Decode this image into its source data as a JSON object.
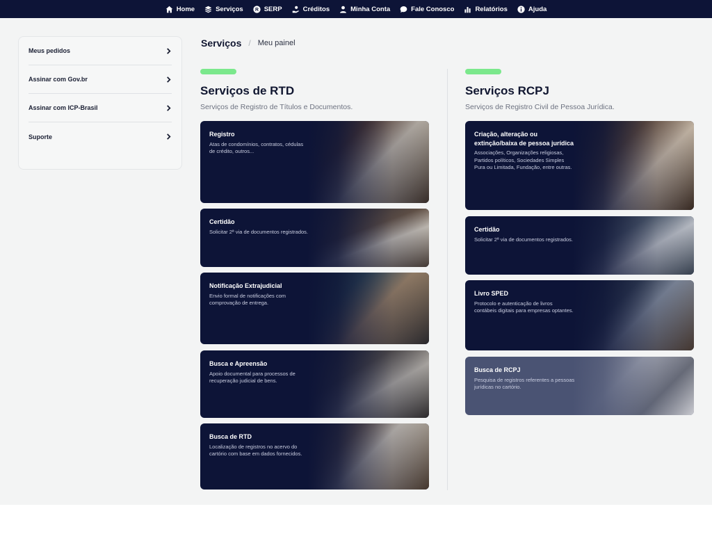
{
  "nav": {
    "items": [
      {
        "label": "Home",
        "icon": "home-icon"
      },
      {
        "label": "Serviços",
        "icon": "layers-icon"
      },
      {
        "label": "SERP",
        "icon": "registered-icon"
      },
      {
        "label": "Créditos",
        "icon": "hand-coin-icon"
      },
      {
        "label": "Minha Conta",
        "icon": "user-icon"
      },
      {
        "label": "Fale Conosco",
        "icon": "chat-icon"
      },
      {
        "label": "Relatórios",
        "icon": "bar-chart-icon"
      },
      {
        "label": "Ajuda",
        "icon": "info-icon"
      }
    ]
  },
  "sidebar": {
    "items": [
      {
        "label": "Meus pedidos"
      },
      {
        "label": "Assinar com Gov.br"
      },
      {
        "label": "Assinar com ICP-Brasil"
      },
      {
        "label": "Suporte"
      }
    ]
  },
  "breadcrumb": {
    "current": "Serviços",
    "separator": "/",
    "sub": "Meu painel"
  },
  "rtd": {
    "title": "Serviços de RTD",
    "subtitle": "Serviços de Registro de Títulos e Documentos.",
    "cards": [
      {
        "title": "Registro",
        "desc": "Atas de condomínios, contratos, cédulas de crédito, outros..."
      },
      {
        "title": "Certidão",
        "desc": "Solicitar 2ª via de documentos registrados."
      },
      {
        "title": "Notificação Extrajudicial",
        "desc": "Envio formal de notificações com comprovação de entrega."
      },
      {
        "title": "Busca e Apreensão",
        "desc": "Apoio documental para processos de recuperação judicial de bens."
      },
      {
        "title": "Busca de RTD",
        "desc": "Localização de registros no acervo do cartório com base em dados fornecidos."
      }
    ]
  },
  "rcpj": {
    "title": "Serviços RCPJ",
    "subtitle": "Serviços de Registro Civil de Pessoa Jurídica.",
    "cards": [
      {
        "title": "Criação, alteração ou extinção/baixa de pessoa jurídica",
        "desc": "Associações, Organizações religiosas, Partidos políticos, Sociedades Simples Pura ou Limitada, Fundação, entre outras."
      },
      {
        "title": "Certidão",
        "desc": "Solicitar 2ª via de documentos registrados."
      },
      {
        "title": "Livro SPED",
        "desc": "Protocolo e autenticação de livros contábeis digitais para empresas optantes."
      },
      {
        "title": "Busca de RCPJ",
        "desc": "Pesquisa de registros referentes a pessoas jurídicas no cartório."
      }
    ]
  },
  "colors": {
    "navy": "#0d1437",
    "accent_green": "#7be88c",
    "page_bg": "#f3f4f4",
    "card_light": "#4a5373"
  }
}
